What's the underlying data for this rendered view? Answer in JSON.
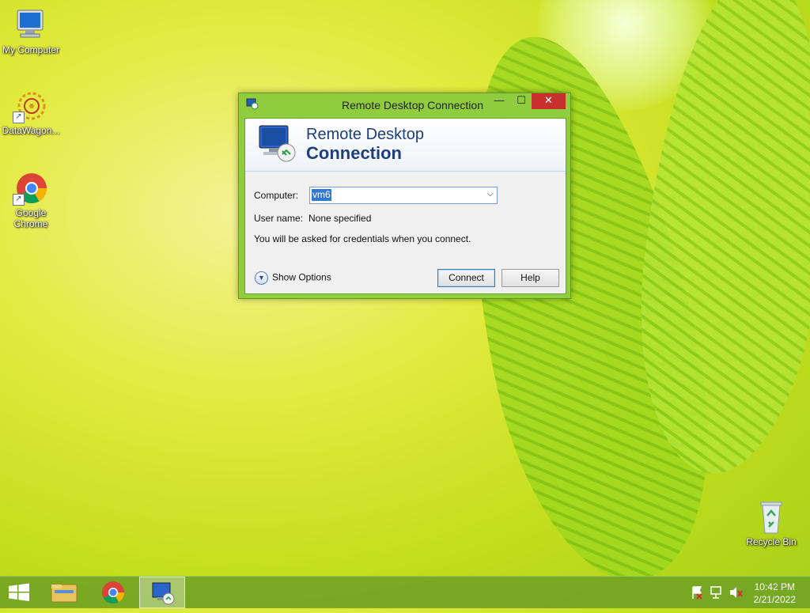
{
  "desktop": {
    "icons": [
      {
        "label": "My Computer"
      },
      {
        "label": "DataWagon..."
      },
      {
        "label": "Google Chrome"
      },
      {
        "label": "Recycle Bin"
      }
    ]
  },
  "dialog": {
    "title": "Remote Desktop Connection",
    "banner_line1": "Remote Desktop",
    "banner_line2": "Connection",
    "computer_label": "Computer:",
    "computer_value": "vm6",
    "username_label": "User name:",
    "username_value": "None specified",
    "info_text": "You will be asked for credentials when you connect.",
    "show_options": "Show Options",
    "connect_button": "Connect",
    "help_button": "Help"
  },
  "taskbar": {
    "time": "10:42 PM",
    "date": "2/21/2022"
  },
  "colors": {
    "desktop_accent": "#c3de1e",
    "dialog_frame": "#8fcd3f",
    "close_button": "#c7302c",
    "banner_text": "#1f3f7a",
    "selection": "#3478d6",
    "taskbar": "#70a224"
  }
}
